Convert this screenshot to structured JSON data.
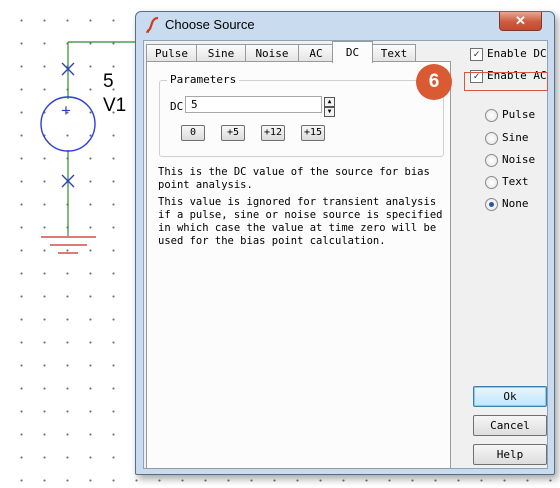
{
  "schematic": {
    "value_label": "5",
    "name_label": "V1",
    "symbol_sign": "+"
  },
  "dialog": {
    "title": "Choose Source",
    "close_glyph": "✕"
  },
  "tabs": [
    {
      "label": "Pulse",
      "active": false
    },
    {
      "label": "Sine",
      "active": false
    },
    {
      "label": "Noise",
      "active": false
    },
    {
      "label": "AC",
      "active": false
    },
    {
      "label": "DC",
      "active": true
    },
    {
      "label": "Text",
      "active": false
    }
  ],
  "parameters": {
    "legend": "Parameters",
    "dc_label": "DC",
    "dc_value": "5",
    "buttons": [
      "0",
      "+5",
      "+12",
      "+15"
    ]
  },
  "description": {
    "line1": "This is the DC value of the source for bias point analysis.",
    "line2": "This value is ignored for transient analysis if a pulse, sine or noise source is specified in which case the value at time zero will be used for the bias point calculation."
  },
  "options": {
    "enable_dc": {
      "label": "Enable DC",
      "checked": true
    },
    "enable_ac": {
      "label": "Enable AC",
      "checked": true
    }
  },
  "callout": {
    "number": "6"
  },
  "source_types": [
    {
      "label": "Pulse",
      "selected": false
    },
    {
      "label": "Sine",
      "selected": false
    },
    {
      "label": "Noise",
      "selected": false
    },
    {
      "label": "Text",
      "selected": false
    },
    {
      "label": "None",
      "selected": true
    }
  ],
  "actions": {
    "ok": "Ok",
    "cancel": "Cancel",
    "help": "Help"
  },
  "colors": {
    "wire": "#2e8b2e",
    "part_blue": "#2a3fd8",
    "probe_blue": "#2a3fb8",
    "ground_red": "#cc2a2a",
    "callout": "#d95a33"
  }
}
